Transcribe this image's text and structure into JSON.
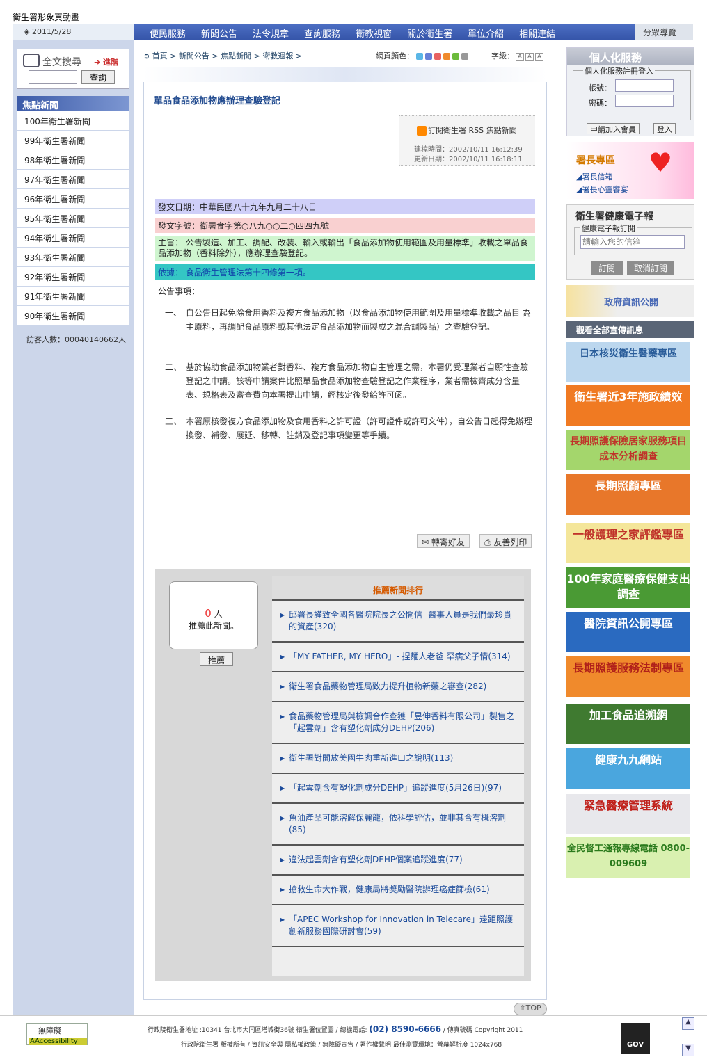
{
  "header": {
    "site_title": "衛生署形象頁動畫",
    "date": "2011/5/28",
    "nav": [
      "便民服務",
      "新聞公告",
      "法令規章",
      "查詢服務",
      "衛教視窗",
      "關於衛生署",
      "單位介紹",
      "相關連結"
    ],
    "sitemap": "分眾導覽"
  },
  "left": {
    "search_label": "全文搜尋",
    "advanced": "進階",
    "search_button": "查詢",
    "focus_title": "焦點新聞",
    "news_years": [
      "100年衛生署新聞",
      "99年衛生署新聞",
      "98年衛生署新聞",
      "97年衛生署新聞",
      "96年衛生署新聞",
      "95年衛生署新聞",
      "94年衛生署新聞",
      "93年衛生署新聞",
      "92年衛生署新聞",
      "91年衛生署新聞",
      "90年衛生署新聞"
    ],
    "visitors": "訪客人數：00040140662人"
  },
  "toolbar": {
    "breadcrumb": "首頁 > 新聞公告 > 焦點新聞 > 衛教週報 >",
    "page_color_label": "網頁顏色：",
    "colors": [
      "#5ab6e6",
      "#6680d8",
      "#e86262",
      "#f08a2c",
      "#6cbb3c",
      "#999999"
    ],
    "font_size_label": "字級：",
    "font_sizes": [
      "A",
      "A",
      "A"
    ]
  },
  "article": {
    "title": "單品食品添加物應辦理查驗登記",
    "rss": "訂閱衛生署 RSS 焦點新聞",
    "created": "建檔時間：2002/10/11 16:12:39",
    "updated": "更新日期：2002/10/11 16:18:11",
    "date_line": "發文日期：中華民國八十九年九月二十八日",
    "doc_no": "發文字號：衛署食字第○八九○○二○四四九號",
    "subject": "主旨： 公告製造、加工、調配、改裝、輸入或輸出「食品添加物使用範圍及用量標準」收載之單品食品添加物（香料除外），應辦理查驗登記。",
    "basis": "依據： 食品衛生管理法第十四條第一項。",
    "notice_heading": "公告事項：",
    "items": [
      {
        "num": "一、",
        "text": "自公告日起免除食用香料及複方食品添加物（以食品添加物使用範圍及用量標準收載之品目 為主原料，再調配食品原料或其他法定食品添加物而製成之混合調製品）之查驗登記。"
      },
      {
        "num": "二、",
        "text": "基於協助食品添加物業者對香料、複方食品添加物自主管理之需，本署仍受理業者自願性查驗登記之申請。該等申請案件比照單品食品添加物查驗登記之作業程序，業者需檢齊成分含量表、規格表及審查費向本署提出申請，經核定後發給許可函。"
      },
      {
        "num": "三、",
        "text": "本署原核發複方食品添加物及食用香料之許可證（許可證件或許可文件），自公告日起得免辦理換發、補發、展延、移轉、註銷及登記事項變更等手續。"
      }
    ],
    "forward": "轉寄好友",
    "print": "友善列印"
  },
  "recommend": {
    "count": "0",
    "unit": "人",
    "label": "推薦此新聞。",
    "button": "推薦",
    "rank_title": "推薦新聞排行",
    "rank": [
      "邱署長謹致全國各醫院院長之公開信 -醫事人員是我們最珍貴的資產(320)",
      "「MY FATHER, MY HERO」- 捏麵人老爸 罕病父子情(314)",
      "衛生署食品藥物管理局致力提升植物新藥之審查(282)",
      "食品藥物管理局與檢調合作查獲「昱伸香料有限公司」製售之「起雲劑」含有塑化劑成分DEHP(206)",
      "衛生署對開放美國牛肉重新進口之說明(113)",
      "「起雲劑含有塑化劑成分DEHP」追蹤進度(5月26日)(97)",
      "魚油產品可能溶解保麗龍，依科學評估，並非其含有概溶劑(85)",
      "違法起雲劑含有塑化劑DEHP個案追蹤進度(77)",
      "搶救生命大作戰，健康局將獎勵醫院辦理癌症篩檢(61)",
      "「APEC Workshop for Innovation in Telecare」遠距照護創新服務國際研討會(59)"
    ],
    "top": "TOP"
  },
  "right": {
    "personal": "個人化服務",
    "login_legend": "個人化服務註冊登入",
    "account": "帳號：",
    "password": "密碼：",
    "join": "申請加入會員",
    "login": "登入",
    "director_zone": "署長專區",
    "director_links": [
      "署長信箱",
      "署長心靈饗宴"
    ],
    "epaper": "衛生署健康電子報",
    "epaper_legend": "健康電子報訂閱",
    "email_placeholder": "請輸入您的信箱",
    "subscribe": "訂閱",
    "unsubscribe": "取消訂閱",
    "gov_info": "政府資訊公開",
    "view_all": "觀看全部宣傳訊息",
    "banners": [
      "日本核災衛生醫藥專區",
      "衛生署近3年施政績效",
      "長期照護保險居家服務項目成本分析調查",
      "長期照顧專區",
      "一般護理之家評鑑專區",
      "100年家庭醫療保健支出調查",
      "醫院資訊公開專區",
      "長期照護服務法制專區",
      "加工食品追溯網",
      "健康九九網站",
      "緊急醫療管理系統",
      "全民督工通報專線電話 0800-009609"
    ]
  },
  "footer": {
    "accessibility": "無障礙",
    "aa": "AAccessibility",
    "address": "行政院衛生署地址 :10341 台北市大同區塔城街36號 衛生署位置圖 / 總機電話:",
    "tel": "(02) 8590-6666",
    "copy": "/ 傳真號碼 Copyright 2011",
    "links": "行政院衛生署 版權所有 / 資訊安全與 隱私權政策 / 無障礙宣告 / 著作權聲明 最佳瀏覽環境：螢幕解析度 1024x768",
    "gov": "GOV"
  }
}
